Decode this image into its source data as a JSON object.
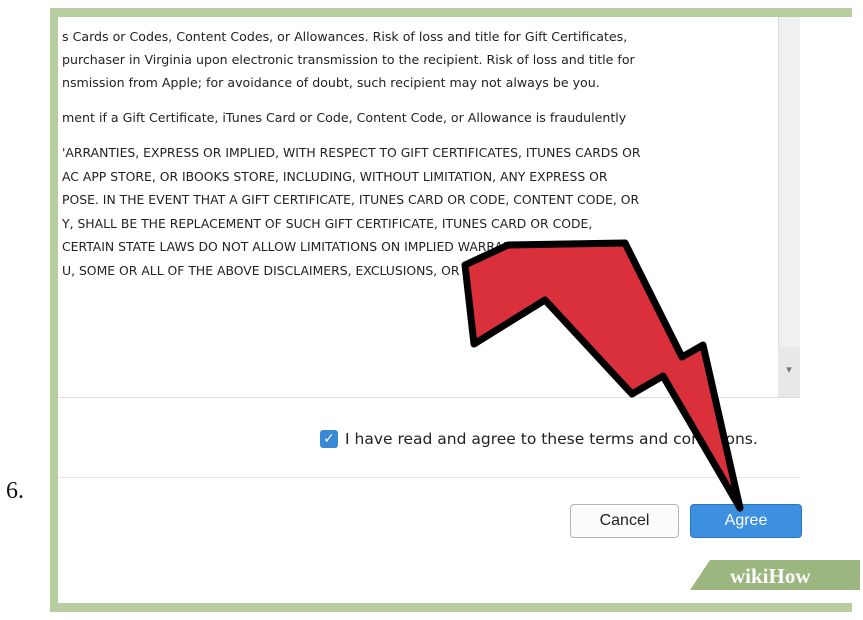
{
  "step": {
    "number": "6."
  },
  "terms": {
    "paragraphs": [
      [
        "s Cards or Codes, Content Codes, or Allowances. Risk of loss and title for Gift Certificates,",
        " purchaser in Virginia upon electronic transmission to the recipient. Risk of loss and title for",
        "nsmission from Apple; for avoidance of doubt, such recipient may not always be you."
      ],
      [
        "ment if a Gift Certificate, iTunes Card or Code, Content Code, or Allowance is fraudulently"
      ],
      [
        "'ARRANTIES, EXPRESS OR IMPLIED, WITH RESPECT TO GIFT CERTIFICATES, ITUNES CARDS OR",
        "AC APP STORE, OR IBOOKS STORE, INCLUDING, WITHOUT LIMITATION, ANY EXPRESS OR",
        "POSE. IN THE EVENT THAT A GIFT CERTIFICATE, ITUNES CARD OR CODE, CONTENT CODE, OR",
        "Y, SHALL BE THE REPLACEMENT OF SUCH GIFT CERTIFICATE, ITUNES CARD OR CODE,",
        " CERTAIN STATE LAWS DO NOT ALLOW LIMITATIONS ON IMPLIED WARRANTIES, THE",
        "U, SOME OR ALL OF THE ABOVE DISCLAIMERS, EXCLUSIONS, OR LIMITATIONS MAY NOT"
      ]
    ]
  },
  "agreement": {
    "checkbox_checked": true,
    "label": "I have read and agree to these terms and conditions."
  },
  "buttons": {
    "cancel": "Cancel",
    "agree": "Agree"
  },
  "watermark": {
    "text": "wikiHow"
  },
  "colors": {
    "frame": "#b7cda0",
    "agree_button": "#3d90e0",
    "checkbox": "#3a89d6",
    "arrow_fill": "#d9303c",
    "arrow_outline": "#000000"
  },
  "icons": {
    "checkbox": "checkmark-icon",
    "scroll_down": "triangle-down-icon",
    "pointer": "arrow-pointer-icon"
  }
}
